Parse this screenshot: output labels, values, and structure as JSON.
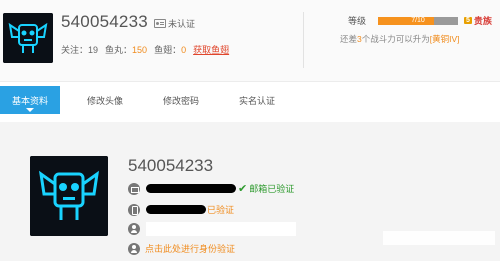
{
  "profile": {
    "username": "540054233",
    "verify_status": "未认证"
  },
  "stats": {
    "follow_label": "关注：",
    "follow_value": "19",
    "fish_ball_label": "鱼丸：",
    "fish_ball_value": "150",
    "fish_fin_label": "鱼翅：",
    "fish_fin_value": "0",
    "get_fin_link": "获取鱼翅"
  },
  "level": {
    "label": "等级",
    "progress_text": "7/10",
    "progress_fraction": 0.7,
    "badge_number": "5",
    "badge_title": "贵族"
  },
  "upgrade_hint": {
    "prefix": "还差",
    "amount": "3",
    "middle": "个战斗力可以升为",
    "next_level": "[黄铜IV]"
  },
  "tabs": [
    {
      "label": "基本资料",
      "active": true
    },
    {
      "label": "修改头像",
      "active": false
    },
    {
      "label": "修改密码",
      "active": false
    },
    {
      "label": "实名认证",
      "active": false
    }
  ],
  "details": {
    "username": "540054233",
    "email_status": "邮箱已验证",
    "phone_status": "已验证",
    "verify_link": "点击此处进行身份验证"
  },
  "colors": {
    "accent_blue": "#2aa1e3",
    "orange": "#f08c1e",
    "green": "#2e9a2e"
  }
}
